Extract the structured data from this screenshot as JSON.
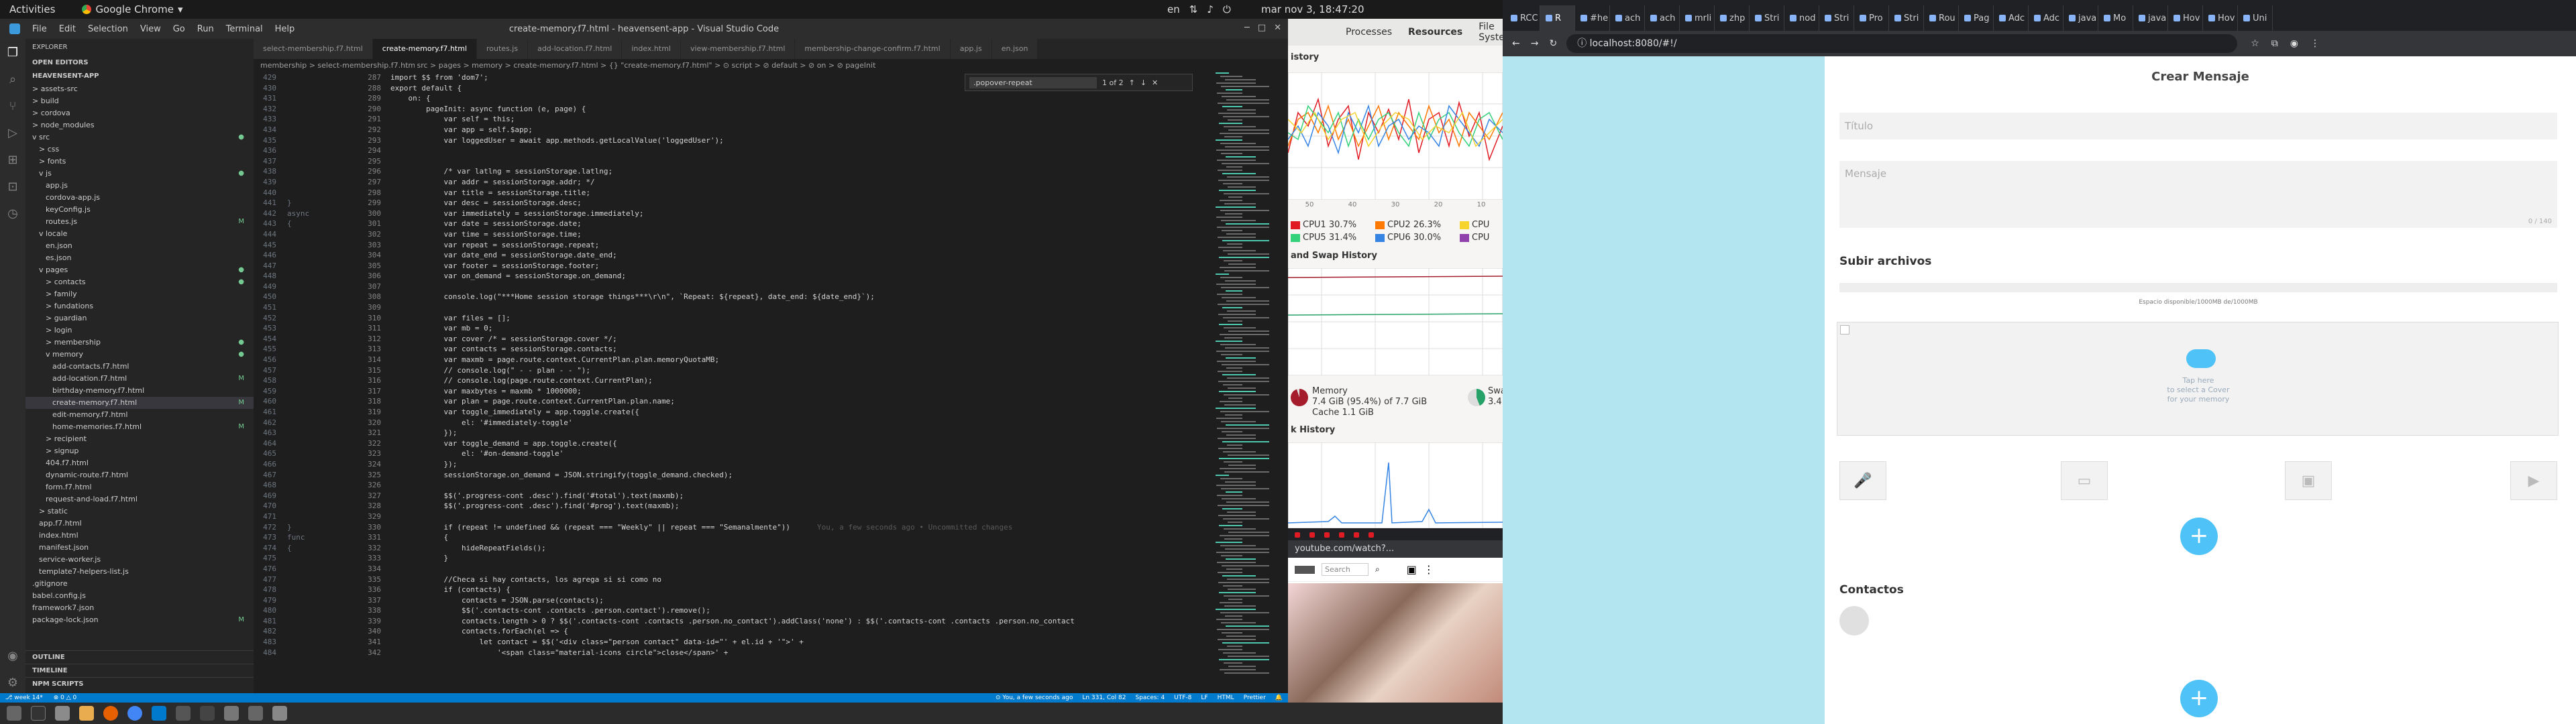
{
  "topbar": {
    "activities": "Activities",
    "app": "Google Chrome",
    "clock": "mar nov  3, 18:47:20",
    "lang": "en"
  },
  "vscode": {
    "title": "create-memory.f7.html - heavensent-app - Visual Studio Code",
    "menu": [
      "File",
      "Edit",
      "Selection",
      "View",
      "Go",
      "Run",
      "Terminal",
      "Help"
    ],
    "explorer_title": "EXPLORER",
    "sections": [
      "OPEN EDITORS",
      "HEAVENSENT-APP"
    ],
    "tree": [
      {
        "label": "> assets-src",
        "indent": 1
      },
      {
        "label": "> build",
        "indent": 1
      },
      {
        "label": "> cordova",
        "indent": 1
      },
      {
        "label": "> node_modules",
        "indent": 1
      },
      {
        "label": "v src",
        "indent": 1,
        "badge": "●"
      },
      {
        "label": "> css",
        "indent": 2
      },
      {
        "label": "> fonts",
        "indent": 2
      },
      {
        "label": "v js",
        "indent": 2,
        "badge": "●"
      },
      {
        "label": "app.js",
        "indent": 3
      },
      {
        "label": "cordova-app.js",
        "indent": 3
      },
      {
        "label": "keyConfig.js",
        "indent": 3
      },
      {
        "label": "routes.js",
        "indent": 3,
        "badge": "M"
      },
      {
        "label": "v locale",
        "indent": 2
      },
      {
        "label": "en.json",
        "indent": 3
      },
      {
        "label": "es.json",
        "indent": 3
      },
      {
        "label": "v pages",
        "indent": 2,
        "badge": "●"
      },
      {
        "label": "> contacts",
        "indent": 3,
        "badge": "●"
      },
      {
        "label": "> family",
        "indent": 3
      },
      {
        "label": "> fundations",
        "indent": 3
      },
      {
        "label": "> guardian",
        "indent": 3
      },
      {
        "label": "> login",
        "indent": 3
      },
      {
        "label": "> membership",
        "indent": 3,
        "badge": "●"
      },
      {
        "label": "v memory",
        "indent": 3,
        "badge": "●"
      },
      {
        "label": "add-contacts.f7.html",
        "indent": 4
      },
      {
        "label": "add-location.f7.html",
        "indent": 4,
        "badge": "M"
      },
      {
        "label": "birthday-memory.f7.html",
        "indent": 4
      },
      {
        "label": "create-memory.f7.html",
        "indent": 4,
        "badge": "M",
        "sel": true
      },
      {
        "label": "edit-memory.f7.html",
        "indent": 4
      },
      {
        "label": "home-memories.f7.html",
        "indent": 4,
        "badge": "M"
      },
      {
        "label": "> recipient",
        "indent": 3
      },
      {
        "label": "> signup",
        "indent": 3
      },
      {
        "label": "404.f7.html",
        "indent": 3
      },
      {
        "label": "dynamic-route.f7.html",
        "indent": 3
      },
      {
        "label": "form.f7.html",
        "indent": 3
      },
      {
        "label": "request-and-load.f7.html",
        "indent": 3
      },
      {
        "label": "> static",
        "indent": 2
      },
      {
        "label": "app.f7.html",
        "indent": 2
      },
      {
        "label": "index.html",
        "indent": 2
      },
      {
        "label": "manifest.json",
        "indent": 2
      },
      {
        "label": "service-worker.js",
        "indent": 2
      },
      {
        "label": "template7-helpers-list.js",
        "indent": 2
      },
      {
        "label": ".gitignore",
        "indent": 1
      },
      {
        "label": "babel.config.js",
        "indent": 1
      },
      {
        "label": "framework7.json",
        "indent": 1
      },
      {
        "label": "package-lock.json",
        "indent": 1,
        "badge": "M"
      }
    ],
    "bottom_sections": [
      "OUTLINE",
      "TIMELINE",
      "NPM SCRIPTS"
    ],
    "tabs": [
      "select-membership.f7.html",
      "routes.js",
      "add-location.f7.html",
      "index.html",
      "view-membership.f7.html",
      "membership-change-confirm.f7.html",
      "app.js",
      "en.json"
    ],
    "active_tab": "create-memory.f7.html",
    "breadcrumb": "src > pages > memory > create-memory.f7.html > {} \"create-memory.f7.html\" > ⊙ script > ⊘ default > ⊘ on > ⊘ pageInit",
    "left_breadcrumb": "membership > select-membership.f7.html > ⊙ script > ⊘ default > ⊘ on",
    "find": {
      "value": ".popover-repeat",
      "result": "1 of 2"
    },
    "lines": [
      {
        "n1": "429",
        "n2": "",
        "n3": "287",
        "t": "import $$ from 'dom7';"
      },
      {
        "n1": "430",
        "n2": "",
        "n3": "288",
        "t": "export default {"
      },
      {
        "n1": "431",
        "n2": "",
        "n3": "289",
        "t": "    on: {"
      },
      {
        "n1": "432",
        "n2": "",
        "n3": "290",
        "t": "        pageInit: async function (e, page) {"
      },
      {
        "n1": "433",
        "n2": "",
        "n3": "291",
        "t": "            var self = this;"
      },
      {
        "n1": "434",
        "n2": "",
        "n3": "292",
        "t": "            var app = self.$app;"
      },
      {
        "n1": "435",
        "n2": "",
        "n3": "293",
        "t": "            var loggedUser = await app.methods.getLocalValue('loggedUser');"
      },
      {
        "n1": "436",
        "n2": "",
        "n3": "294",
        "t": ""
      },
      {
        "n1": "437",
        "n2": "",
        "n3": "295",
        "t": ""
      },
      {
        "n1": "438",
        "n2": "",
        "n3": "296",
        "t": "            /* var latlng = sessionStorage.latlng;"
      },
      {
        "n1": "439",
        "n2": "",
        "n3": "297",
        "t": "            var addr = sessionStorage.addr; */"
      },
      {
        "n1": "440",
        "n2": "",
        "n3": "298",
        "t": "            var title = sessionStorage.title;"
      },
      {
        "n1": "441",
        "n2": "}",
        "n3": "299",
        "t": "            var desc = sessionStorage.desc;"
      },
      {
        "n1": "442",
        "n2": "async",
        "n3": "300",
        "t": "            var immediately = sessionStorage.immediately;"
      },
      {
        "n1": "443",
        "n2": "{",
        "n3": "301",
        "t": "            var date = sessionStorage.date;"
      },
      {
        "n1": "444",
        "n2": "",
        "n3": "302",
        "t": "            var time = sessionStorage.time;"
      },
      {
        "n1": "445",
        "n2": "",
        "n3": "303",
        "t": "            var repeat = sessionStorage.repeat;"
      },
      {
        "n1": "446",
        "n2": "",
        "n3": "304",
        "t": "            var date_end = sessionStorage.date_end;"
      },
      {
        "n1": "447",
        "n2": "",
        "n3": "305",
        "t": "            var footer = sessionStorage.footer;"
      },
      {
        "n1": "448",
        "n2": "",
        "n3": "306",
        "t": "            var on_demand = sessionStorage.on_demand;"
      },
      {
        "n1": "449",
        "n2": "",
        "n3": "307",
        "t": ""
      },
      {
        "n1": "450",
        "n2": "",
        "n3": "308",
        "t": "            console.log(\"***Home session storage things***\\r\\n\", `Repeat: ${repeat}, date_end: ${date_end}`);"
      },
      {
        "n1": "451",
        "n2": "",
        "n3": "309",
        "t": ""
      },
      {
        "n1": "452",
        "n2": "",
        "n3": "310",
        "t": "            var files = [];"
      },
      {
        "n1": "453",
        "n2": "",
        "n3": "311",
        "t": "            var mb = 0;"
      },
      {
        "n1": "454",
        "n2": "",
        "n3": "312",
        "t": "            var cover /* = sessionStorage.cover */;"
      },
      {
        "n1": "455",
        "n2": "",
        "n3": "313",
        "t": "            var contacts = sessionStorage.contacts;"
      },
      {
        "n1": "456",
        "n2": "",
        "n3": "314",
        "t": "            var maxmb = page.route.context.CurrentPlan.plan.memoryQuotaMB;"
      },
      {
        "n1": "457",
        "n2": "",
        "n3": "315",
        "t": "            // console.log(\" - - plan - - \");"
      },
      {
        "n1": "458",
        "n2": "",
        "n3": "316",
        "t": "            // console.log(page.route.context.CurrentPlan);"
      },
      {
        "n1": "459",
        "n2": "",
        "n3": "317",
        "t": "            var maxbytes = maxmb * 1000000;"
      },
      {
        "n1": "460",
        "n2": "",
        "n3": "318",
        "t": "            var plan = page.route.context.CurrentPlan.plan.name;"
      },
      {
        "n1": "461",
        "n2": "",
        "n3": "319",
        "t": "            var toggle_immediately = app.toggle.create({"
      },
      {
        "n1": "462",
        "n2": "",
        "n3": "320",
        "t": "                el: '#immediately-toggle'"
      },
      {
        "n1": "463",
        "n2": "",
        "n3": "321",
        "t": "            });"
      },
      {
        "n1": "464",
        "n2": "",
        "n3": "322",
        "t": "            var toggle_demand = app.toggle.create({"
      },
      {
        "n1": "465",
        "n2": "",
        "n3": "323",
        "t": "                el: '#on-demand-toggle'"
      },
      {
        "n1": "466",
        "n2": "",
        "n3": "324",
        "t": "            });"
      },
      {
        "n1": "467",
        "n2": "",
        "n3": "325",
        "t": "            sessionStorage.on_demand = JSON.stringify(toggle_demand.checked);"
      },
      {
        "n1": "468",
        "n2": "",
        "n3": "326",
        "t": ""
      },
      {
        "n1": "469",
        "n2": "",
        "n3": "327",
        "t": "            $$('.progress-cont .desc').find('#total').text(maxmb);"
      },
      {
        "n1": "470",
        "n2": "",
        "n3": "328",
        "t": "            $$('.progress-cont .desc').find('#prog').text(maxmb);"
      },
      {
        "n1": "471",
        "n2": "",
        "n3": "329",
        "t": ""
      },
      {
        "n1": "472",
        "n2": "}",
        "n3": "330",
        "t": "            if (repeat != undefined && (repeat === \"Weekly\" || repeat === \"Semanalmente\"))"
      },
      {
        "n1": "473",
        "n2": "func",
        "n3": "331",
        "t": "            {"
      },
      {
        "n1": "474",
        "n2": "{",
        "n3": "332",
        "t": "                hideRepeatFields();"
      },
      {
        "n1": "475",
        "n2": "",
        "n3": "333",
        "t": "            }"
      },
      {
        "n1": "476",
        "n2": "",
        "n3": "334",
        "t": ""
      },
      {
        "n1": "477",
        "n2": "",
        "n3": "335",
        "t": "            //Checa si hay contacts, los agrega si si como no"
      },
      {
        "n1": "478",
        "n2": "",
        "n3": "336",
        "t": "            if (contacts) {"
      },
      {
        "n1": "479",
        "n2": "",
        "n3": "337",
        "t": "                contacts = JSON.parse(contacts);"
      },
      {
        "n1": "480",
        "n2": "",
        "n3": "338",
        "t": "                $$('.contacts-cont .contacts .person.contact').remove();"
      },
      {
        "n1": "481",
        "n2": "",
        "n3": "339",
        "t": "                contacts.length > 0 ? $$('.contacts-cont .contacts .person.no_contact').addClass('none') : $$('.contacts-cont .contacts .person.no_contact"
      },
      {
        "n1": "482",
        "n2": "",
        "n3": "340",
        "t": "                contacts.forEach(el => {"
      },
      {
        "n1": "483",
        "n2": "",
        "n3": "341",
        "t": "                    let contact = $$('<div class=\"person contact\" data-id=\"' + el.id + '\">' +"
      },
      {
        "n1": "484",
        "n2": "",
        "n3": "342",
        "t": "                        '<span class=\"material-icons circle\">close</span>' +"
      }
    ],
    "inline_hint": "You, a few seconds ago • Uncommitted changes",
    "status_left": [
      "⎇ week 14*",
      "⊗ 0 △ 0"
    ],
    "status_right": [
      "⊙ You, a few seconds ago",
      "Ln 331, Col 82",
      "Spaces: 4",
      "UTF-8",
      "LF",
      "HTML",
      "Prettier"
    ]
  },
  "sysmon": {
    "tabs": [
      "Processes",
      "Resources",
      "File Systems"
    ],
    "cpu_history_partial": "istory",
    "cpus": [
      {
        "label": "CPU1 30.7%",
        "color": "#e01b24"
      },
      {
        "label": "CPU2 26.3%",
        "color": "#ff7800"
      },
      {
        "label": "CPU",
        "color": "#f6d32d"
      },
      {
        "label": "CPU5 31.4%",
        "color": "#33d17a"
      },
      {
        "label": "CPU6 30.0%",
        "color": "#3584e4"
      },
      {
        "label": "CPU",
        "color": "#9141ac"
      }
    ],
    "mem_header": "and Swap History",
    "memory_label": "Memory",
    "memory_value": "7.4 GiB (95.4%) of 7.7 GiB",
    "cache": "Cache 1.1 GiB",
    "swap_label": "Swa",
    "swap_value": "3.4",
    "net_header": "k History",
    "xticks": [
      "50",
      "40",
      "30",
      "20",
      "10"
    ]
  },
  "youtube": {
    "url": "youtube.com/watch?...",
    "search": "Search"
  },
  "chrome": {
    "tabs": [
      "RCC",
      "R",
      "#he",
      "ach",
      "ach",
      "mrli",
      "zhp",
      "Stri",
      "nod",
      "Stri",
      "Pro",
      "Stri",
      "Rou",
      "Pag",
      "Adc",
      "Adc",
      "java",
      "Mo",
      "java",
      "Hov",
      "Hov",
      "Uni"
    ],
    "url": "localhost:8080/#!/",
    "page": {
      "title": "Crear Mensaje",
      "title_placeholder": "Título",
      "message_placeholder": "Mensaje",
      "char_count": "0 / 140",
      "upload_header": "Subir archivos",
      "space": "Espacio disponible/1000MB de/1000MB",
      "tap_text": [
        "Tap here",
        "to select a Cover",
        "for your memory"
      ],
      "contacts_header": "Contactos"
    }
  }
}
